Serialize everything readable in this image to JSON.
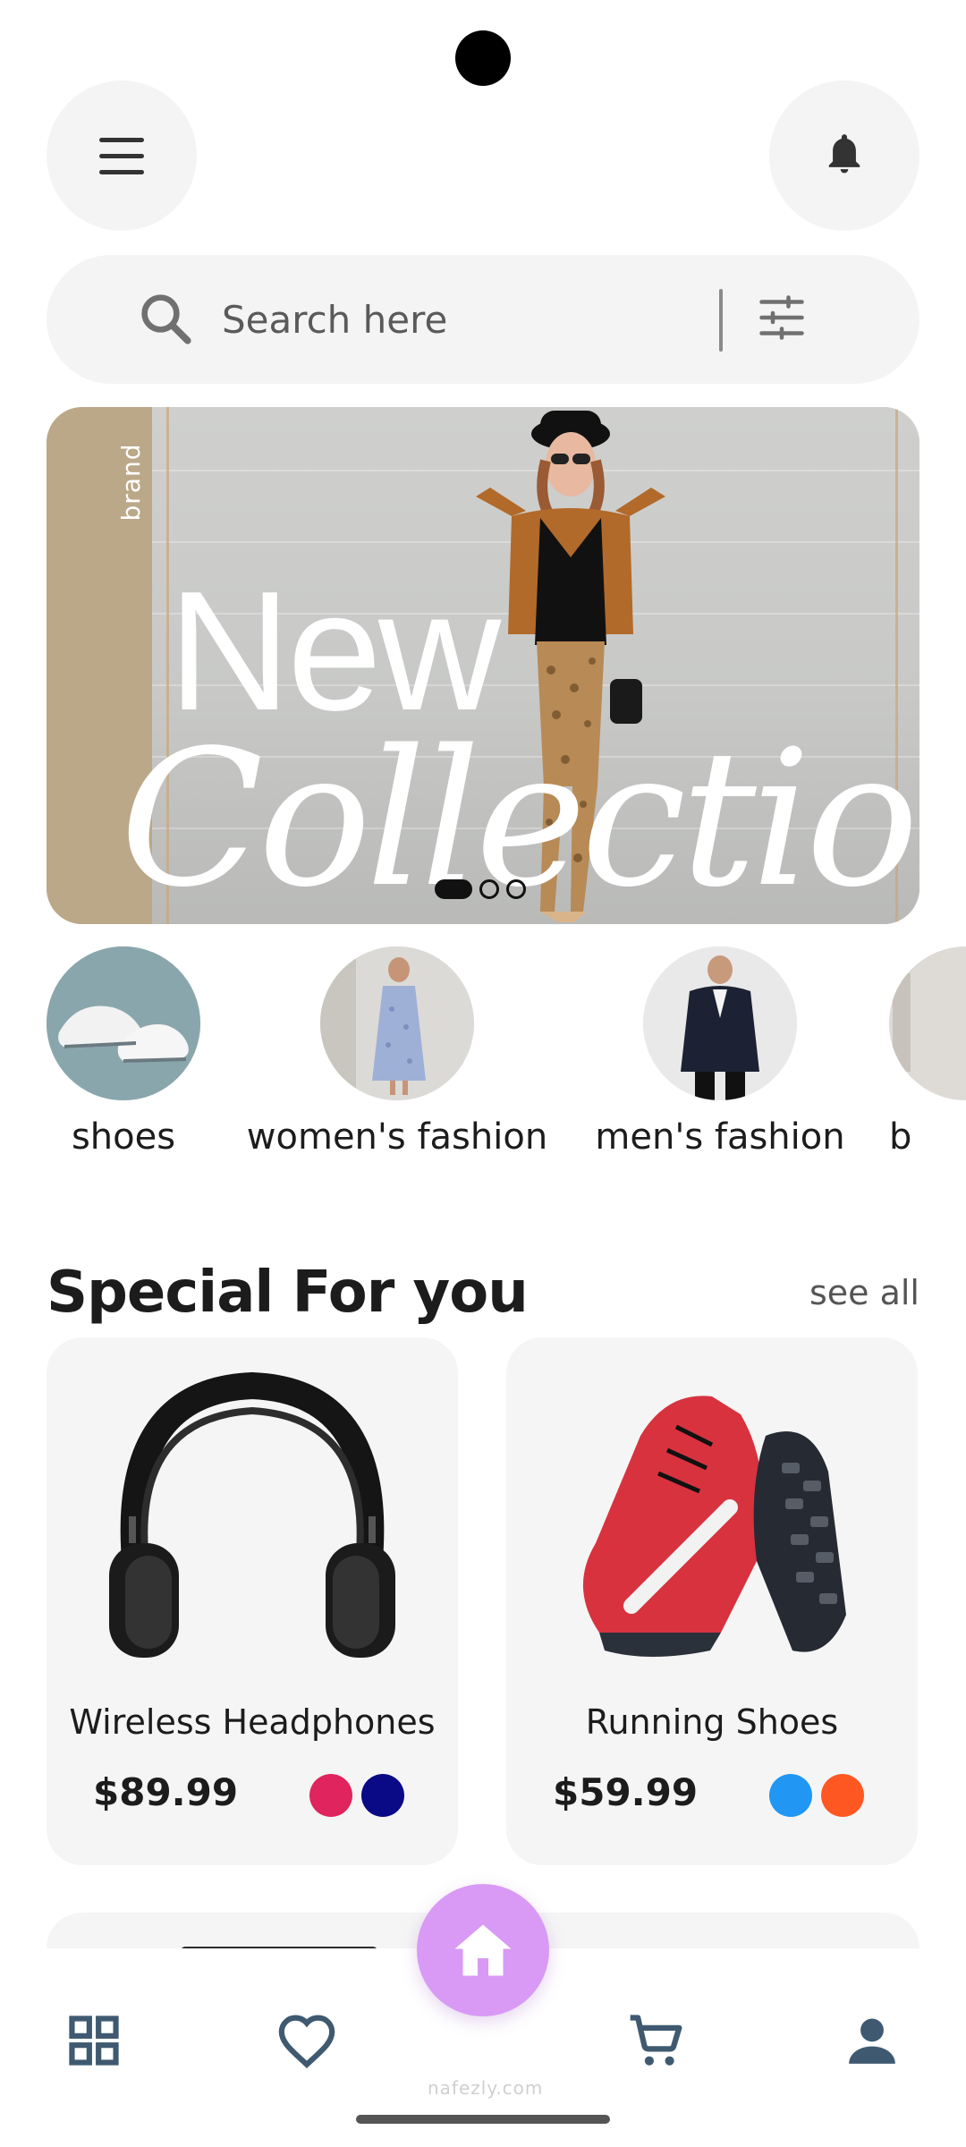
{
  "header": {
    "menu_icon": "hamburger-icon",
    "notification_icon": "bell-icon"
  },
  "search": {
    "placeholder": "Search here",
    "value": "",
    "search_icon": "search-icon",
    "filter_icon": "sliders-icon"
  },
  "banner": {
    "brand_text": "brand",
    "headline": "New",
    "subheadline": "Collection",
    "slide_count": 3,
    "active_slide": 1
  },
  "categories": [
    {
      "label": "shoes"
    },
    {
      "label": "women's fashion"
    },
    {
      "label": "men's fashion"
    },
    {
      "label": "b"
    }
  ],
  "special": {
    "title": "Special For you",
    "see_all_label": "see all",
    "products": [
      {
        "name": "Wireless Headphones",
        "price": "$89.99",
        "colors": [
          "#e0245e",
          "#0b0a86"
        ]
      },
      {
        "name": "Running Shoes",
        "price": "$59.99",
        "colors": [
          "#2196f3",
          "#ff5722"
        ]
      }
    ]
  },
  "bottom_nav": {
    "items": [
      "grid-icon",
      "heart-icon",
      "home-icon",
      "cart-icon",
      "user-icon"
    ],
    "active": "home-icon",
    "icon_color": "#3f5a70",
    "fab_color": "#d89af4"
  },
  "watermark": "nafezly.com"
}
